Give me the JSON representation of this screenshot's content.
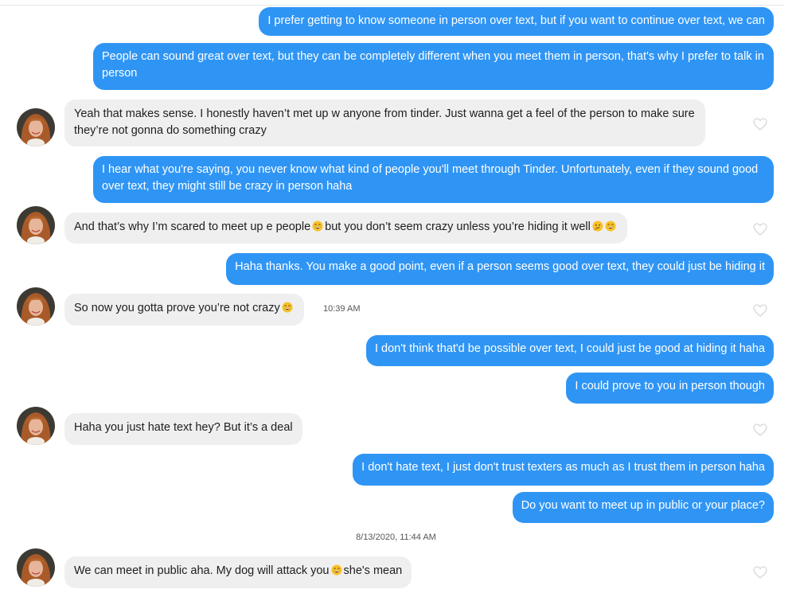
{
  "messages": [
    {
      "id": "m1",
      "side": "sent",
      "text": "I prefer getting to know someone in person over text, but if you want to continue over text, we can"
    },
    {
      "id": "m2",
      "side": "sent",
      "text": "People can sound great over text, but they can be completely different when you meet them in person, that's why I prefer to talk in person"
    },
    {
      "id": "m3",
      "side": "received",
      "text": "Yeah that makes sense. I honestly haven’t met up w anyone from tinder. Just wanna get a feel of the person to make sure they’re not gonna do something crazy"
    },
    {
      "id": "m4",
      "side": "sent",
      "text": "I hear what you're saying, you never know what kind of people you'll meet through Tinder. Unfortunately, even if they sound good over text, they might still be crazy in person haha"
    },
    {
      "id": "m5",
      "side": "received",
      "text_a": "And that’s why I’m scared to meet up e people",
      "text_b": "but you don’t seem crazy unless you’re hiding it well"
    },
    {
      "id": "m6",
      "side": "sent",
      "text": "Haha thanks. You make a good point, even if a person seems good over text, they could just be hiding it"
    },
    {
      "id": "m7",
      "side": "received",
      "text": "So now you gotta prove you’re not crazy",
      "time": "10:39 AM"
    },
    {
      "id": "m8",
      "side": "sent",
      "text": "I don't think that'd be possible over text, I could just be good at hiding it haha"
    },
    {
      "id": "m9",
      "side": "sent",
      "text": "I could prove to you in person though"
    },
    {
      "id": "m10",
      "side": "received",
      "text": "Haha you just hate text hey? But it’s a deal"
    },
    {
      "id": "m11",
      "side": "sent",
      "text": "I don't hate text, I just don't trust texters as much as I trust them in person haha"
    },
    {
      "id": "m12",
      "side": "sent",
      "text": "Do you want to meet up in public or your place?"
    },
    {
      "id": "m13",
      "side": "received",
      "text_a": "We can meet in public aha. My dog will attack you",
      "text_b": "she's mean"
    }
  ],
  "date_separator": "8/13/2020, 11:44 AM",
  "colors": {
    "sent_bubble": "#2f95f5",
    "received_bubble": "#efefef",
    "heart_outline": "#d8d8d8"
  },
  "icons": {
    "like": "heart-outline-icon",
    "emoji_grin": "grinning-sweat-emoji",
    "emoji_thinking": "thinking-emoji"
  }
}
